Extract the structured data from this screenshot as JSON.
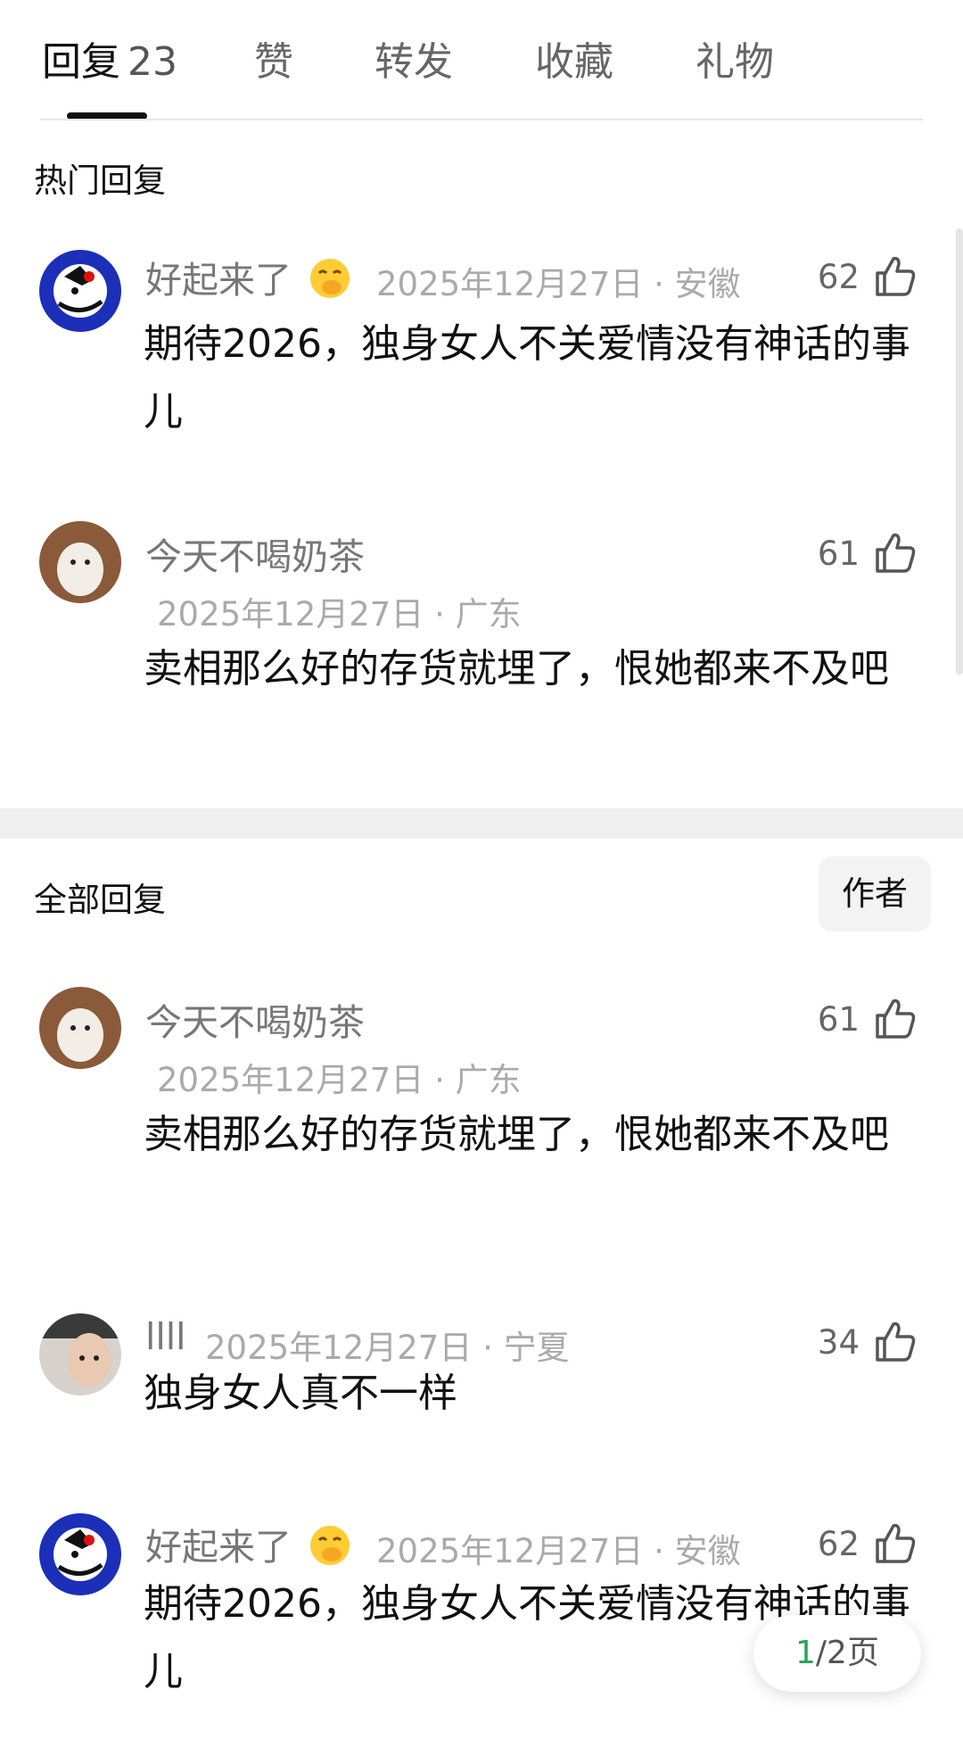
{
  "tabs": [
    {
      "label": "回复",
      "count": "23"
    },
    {
      "label": "赞"
    },
    {
      "label": "转发"
    },
    {
      "label": "收藏"
    },
    {
      "label": "礼物"
    }
  ],
  "hot_section_title": "热门回复",
  "all_section_title": "全部回复",
  "author_filter_label": "作者",
  "hot_comments": [
    {
      "user": "好起来了",
      "emoji": "hand-over-mouth-emoji",
      "date": "2025年12月27日 · 安徽",
      "likes": "62",
      "text": "期待2026，独身女人不关爱情没有神话的事儿"
    },
    {
      "user": "今天不喝奶茶",
      "date": "2025年12月27日 · 广东",
      "likes": "61",
      "text": "卖相那么好的存货就埋了，恨她都来不及吧"
    }
  ],
  "all_comments": [
    {
      "user": "今天不喝奶茶",
      "date": "2025年12月27日 · 广东",
      "likes": "61",
      "text": "卖相那么好的存货就埋了，恨她都来不及吧"
    },
    {
      "user": "llll",
      "date": "2025年12月27日 · 宁夏",
      "likes": "34",
      "text": "独身女人真不一样"
    },
    {
      "user": "好起来了",
      "emoji": "hand-over-mouth-emoji",
      "date": "2025年12月27日 · 安徽",
      "likes": "62",
      "text": "期待2026，独身女人不关爱情没有神话的事儿"
    }
  ],
  "pager": {
    "current": "1",
    "rest": "/2页"
  },
  "colors": {
    "accent_green": "#2aa45a",
    "meta_gray": "#aaaaaa",
    "username_gray": "#777777"
  }
}
